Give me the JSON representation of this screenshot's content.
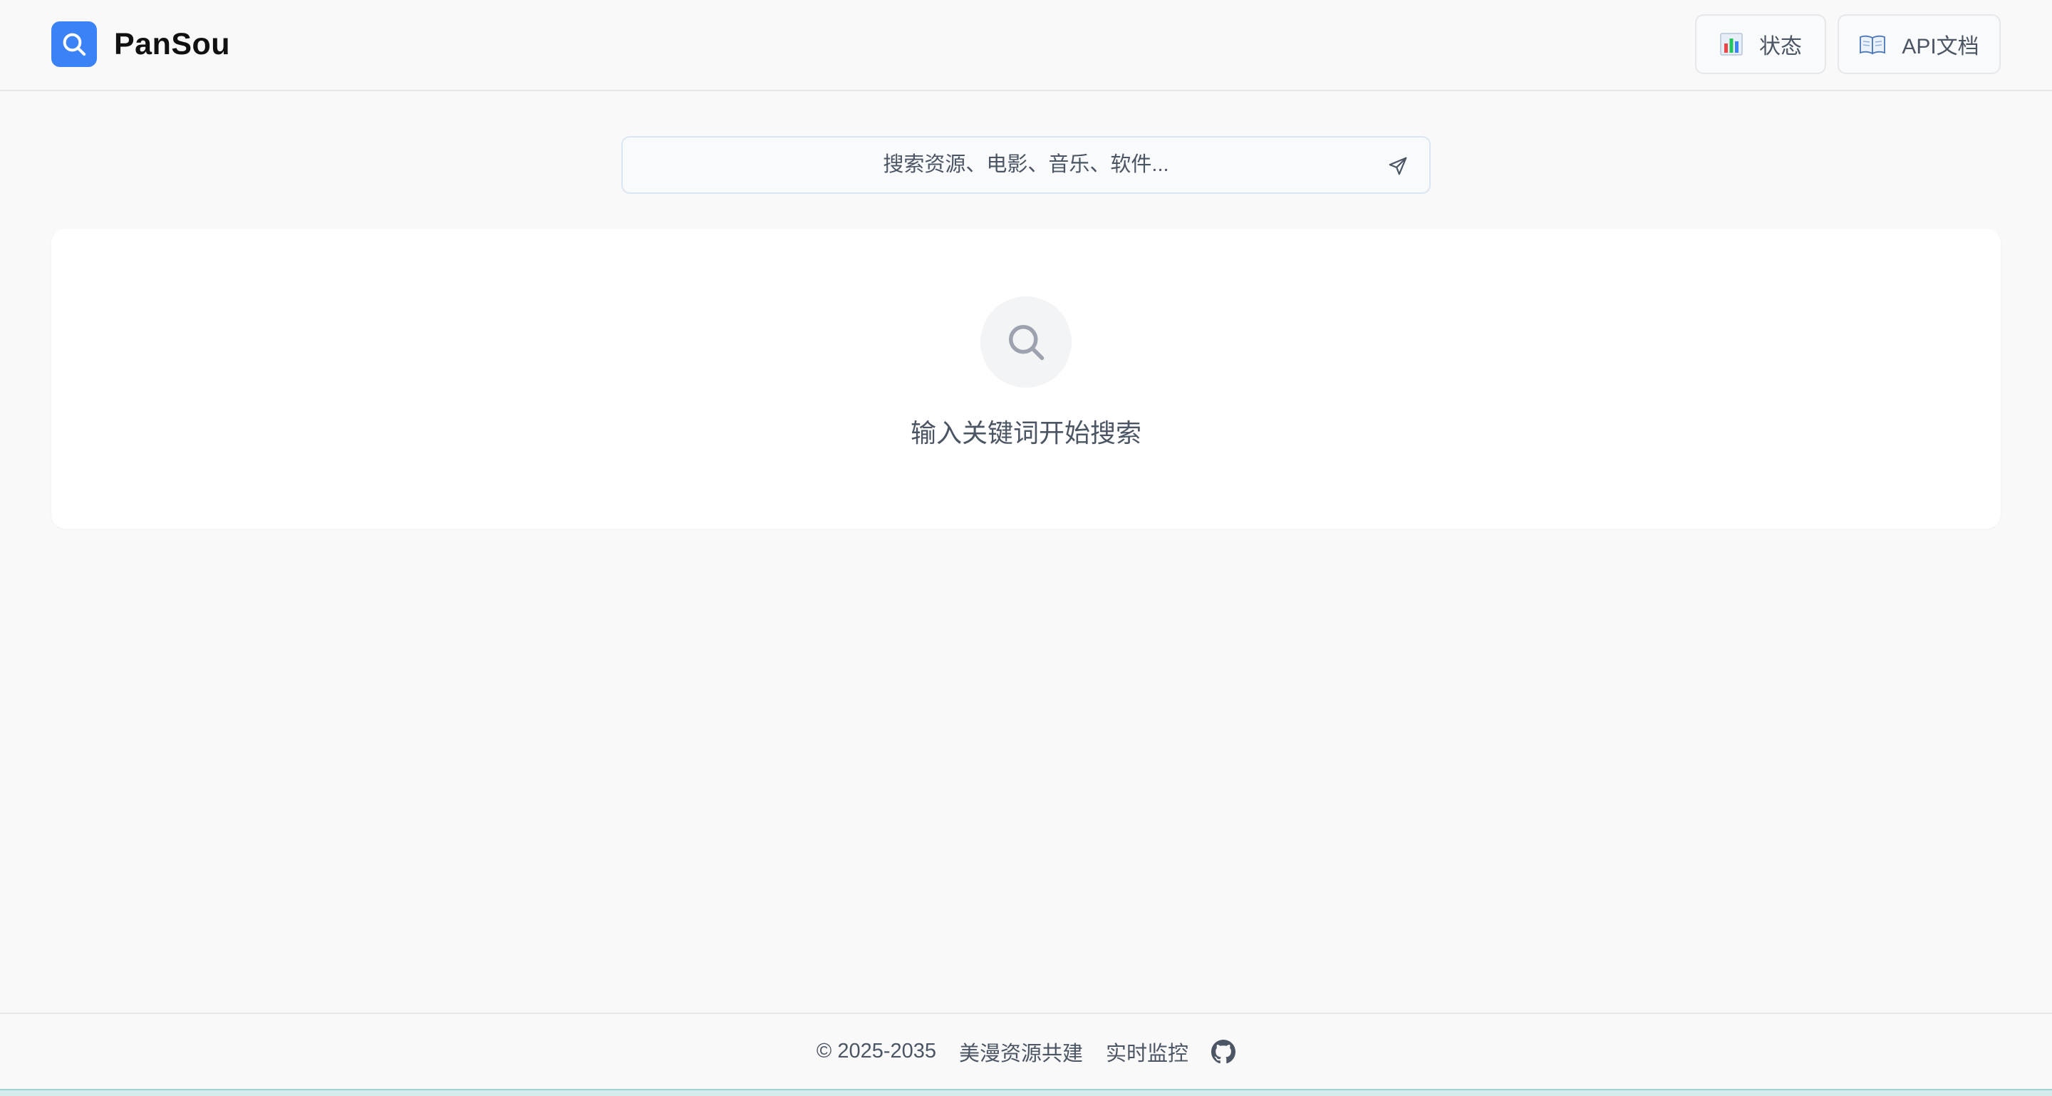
{
  "header": {
    "brand": "PanSou",
    "logo_icon": "search-icon",
    "status_button": {
      "label": "状态",
      "icon": "bar-chart-icon"
    },
    "api_button": {
      "label": "API文档",
      "icon": "open-book-icon"
    }
  },
  "search": {
    "placeholder": "搜索资源、电影、音乐、软件...",
    "value": "",
    "submit_icon": "send-icon"
  },
  "empty_state": {
    "icon": "search-icon",
    "message": "输入关键词开始搜索"
  },
  "footer": {
    "copyright": "© 2025-2035",
    "link_community": "美漫资源共建",
    "link_monitor": "实时监控",
    "github_icon": "github-icon"
  },
  "colors": {
    "accent": "#3b82f6",
    "background": "#f9f9f9",
    "card": "#ffffff",
    "muted_text": "#4b5563"
  }
}
